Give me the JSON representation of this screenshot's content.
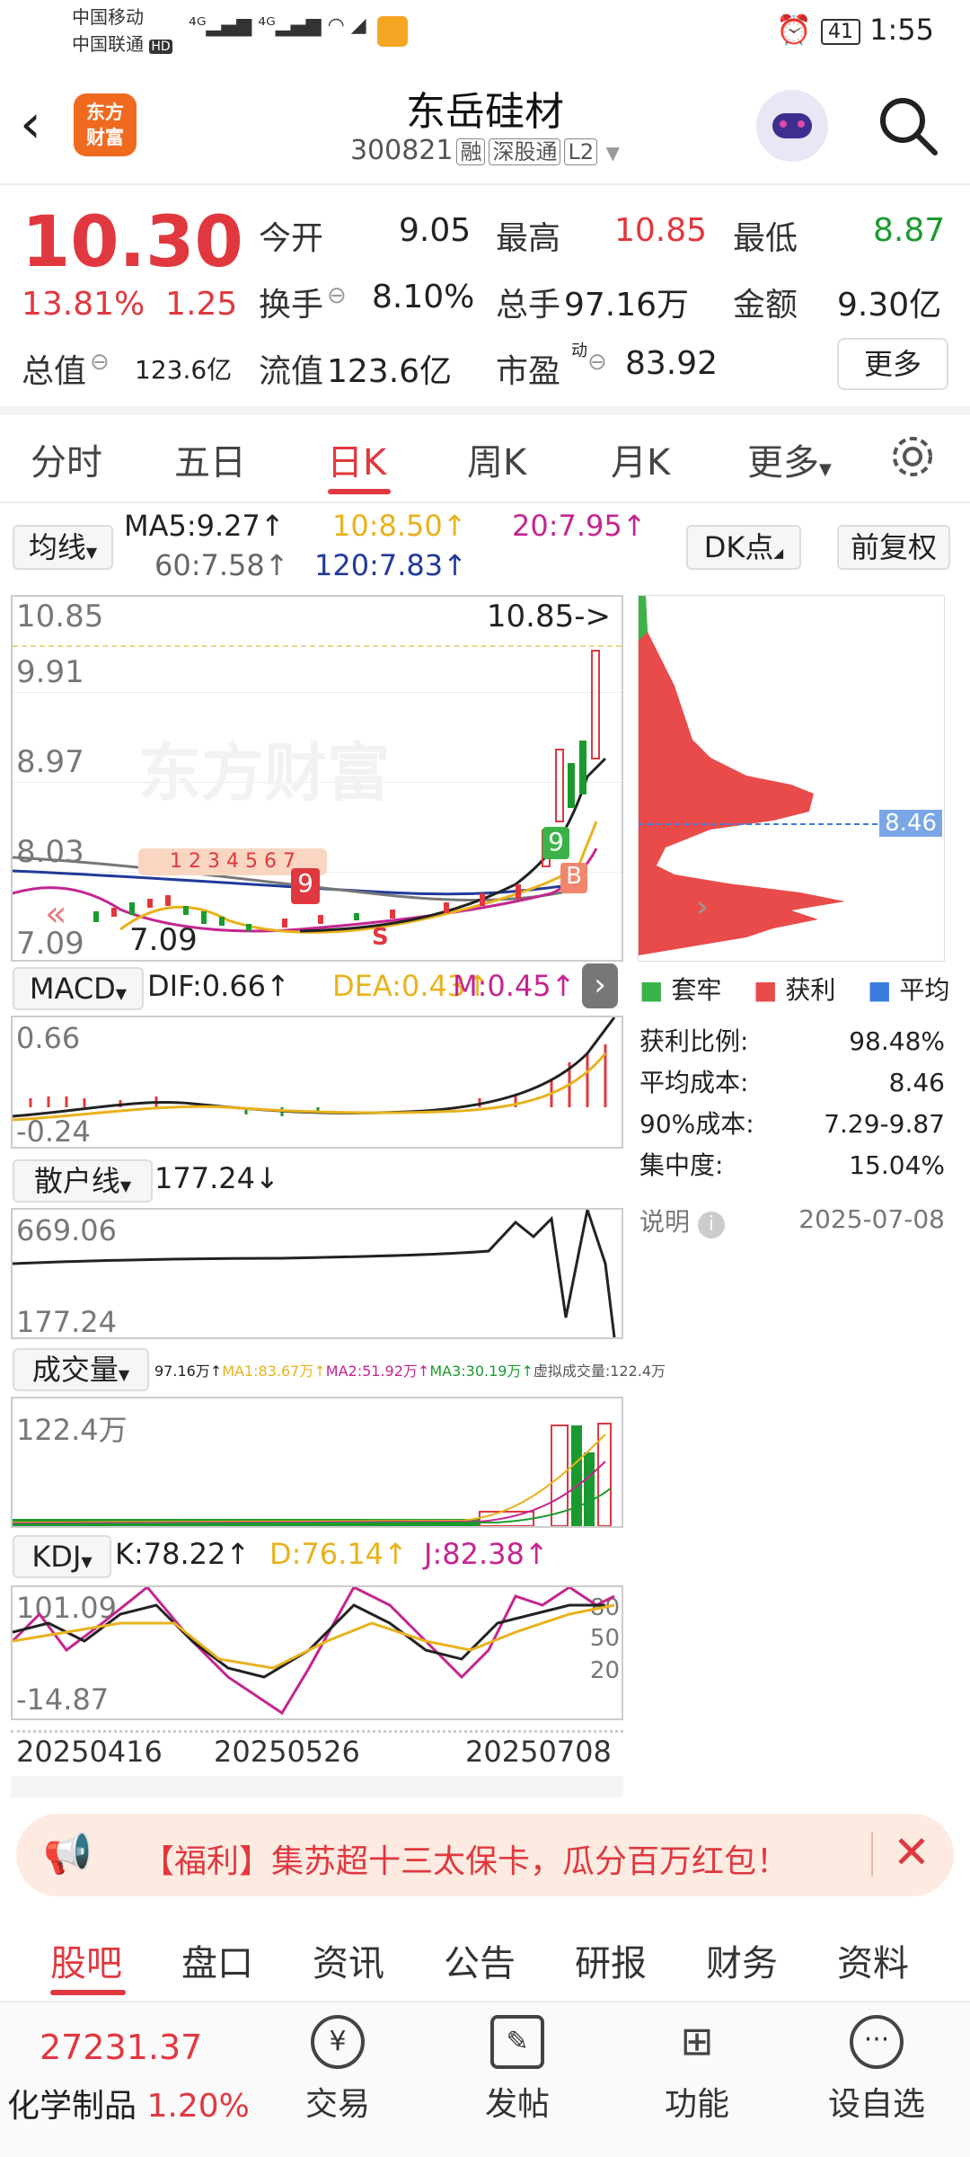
{
  "status_bar": {
    "carrier1": "中国移动",
    "carrier2": "中国联通",
    "hd": "HD",
    "battery": "41",
    "time": "1:55"
  },
  "header": {
    "back_icon": "chevron-left-icon",
    "logo_line1": "东方",
    "logo_line2": "财富",
    "title": "东岳硅材",
    "code": "300821",
    "tags": [
      "融",
      "深股通",
      "L2"
    ],
    "search_icon": "search-icon"
  },
  "quote": {
    "price": "10.30",
    "change_pct": "13.81%",
    "change_amt": "1.25",
    "open_label": "今开",
    "open": "9.05",
    "high_label": "最高",
    "high": "10.85",
    "low_label": "最低",
    "low": "8.87",
    "turnover_label": "换手",
    "turnover": "8.10%",
    "volume_label": "总手",
    "volume": "97.16万",
    "amount_label": "金额",
    "amount": "9.30亿",
    "mcap_label": "总值",
    "mcap": "123.6亿",
    "float_label": "流值",
    "float_cap": "123.6亿",
    "pe_label": "市盈",
    "pe_sup": "动",
    "pe": "83.92",
    "more": "更多"
  },
  "tabs": [
    "分时",
    "五日",
    "日K",
    "周K",
    "月K",
    "更多"
  ],
  "active_tab": "日K",
  "chart": {
    "ma_btn": "均线",
    "ma5": "MA5:9.27↑",
    "ma10": "10:8.50↑",
    "ma20": "20:7.95↑",
    "ma60": "60:7.58↑",
    "ma120": "120:7.83↑",
    "dk_btn": "DK点",
    "fq_btn": "前复权",
    "price_high": "10.85",
    "price_high_arrow": "10.85->",
    "tick1": "9.91",
    "tick2": "8.97",
    "tick3": "8.03",
    "price_low": "7.09",
    "low_mark": "7.09",
    "macd_btn": "MACD",
    "dif": "DIF:0.66↑",
    "dea": "DEA:0.43↑",
    "m": "M:0.45↑",
    "macd_top": "0.66",
    "macd_bot": "-0.24",
    "retail_btn": "散户线",
    "retail_val": "177.24↓",
    "retail_top": "669.06",
    "retail_bot": "177.24",
    "vol_btn": "成交量",
    "vol_legend": "97.16万↑",
    "vol_ma1": "MA1:83.67万↑",
    "vol_ma2": "MA2:51.92万↑",
    "vol_ma3": "MA3:30.19万↑",
    "vol_virtual": "虚拟成交量:122.4万",
    "vol_top": "122.4万",
    "kdj_btn": "KDJ",
    "k": "K:78.22↑",
    "d": "D:76.14↑",
    "j": "J:82.38↑",
    "kdj_top": "101.09",
    "kdj_bot": "-14.87",
    "kdj_80": "80",
    "kdj_50": "50",
    "kdj_20": "20",
    "dates": [
      "20250416",
      "20250526",
      "20250708"
    ],
    "markers": [
      "1",
      "2",
      "3",
      "4",
      "5",
      "6",
      "7",
      "9",
      "B",
      "S"
    ]
  },
  "chip": {
    "avg_marker": "8.46",
    "legend": [
      "套牢",
      "获利",
      "平均"
    ],
    "legend_colors": [
      "#3cb34a",
      "#e94b4b",
      "#3a7be0"
    ],
    "rows": [
      {
        "label": "获利比例:",
        "value": "98.48%"
      },
      {
        "label": "平均成本:",
        "value": "8.46"
      },
      {
        "label": "90%成本:",
        "value": "7.29-9.87"
      },
      {
        "label": "集中度:",
        "value": "15.04%"
      }
    ],
    "note": "说明",
    "date": "2025-07-08"
  },
  "promo": {
    "text": "【福利】集苏超十三太保卡，瓜分百万红包！"
  },
  "bottom_tabs": [
    "股吧",
    "盘口",
    "资讯",
    "公告",
    "研报",
    "财务",
    "资料"
  ],
  "footer": {
    "index_value": "27231.37",
    "index_name": "化学制品",
    "index_pct": "1.20%",
    "items": [
      "交易",
      "发帖",
      "功能",
      "设自选"
    ]
  }
}
